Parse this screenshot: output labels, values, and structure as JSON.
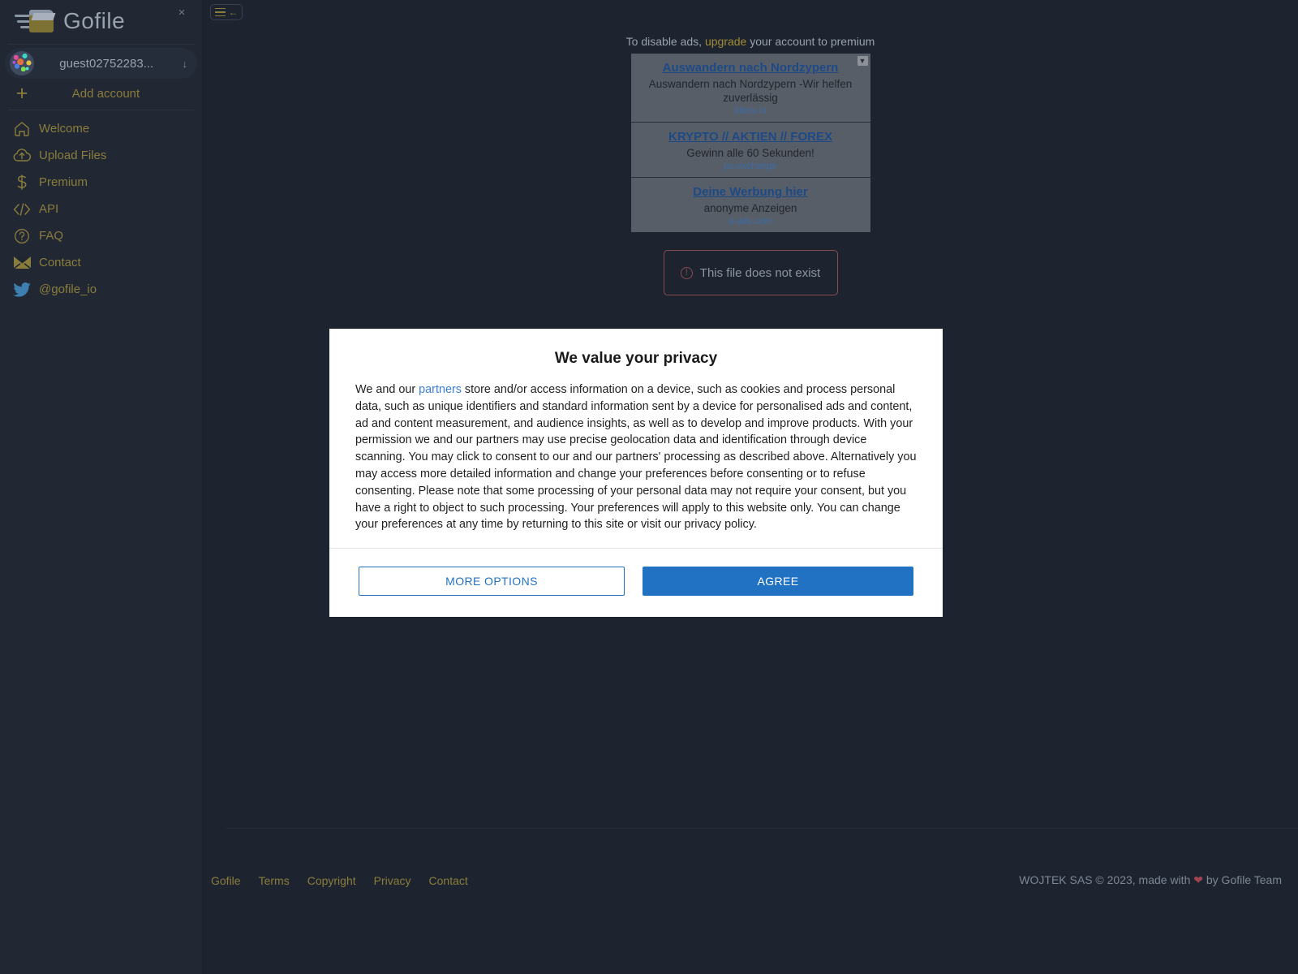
{
  "sidebar": {
    "brand": "Gofile",
    "close_label": "×",
    "account": {
      "name": "guest02752283...",
      "caret": "↓"
    },
    "add_account": {
      "plus": "+",
      "label": "Add account"
    },
    "nav_items": [
      {
        "icon": "home-icon",
        "label": "Welcome"
      },
      {
        "icon": "upload-icon",
        "label": "Upload Files"
      },
      {
        "icon": "dollar-icon",
        "label": "Premium"
      },
      {
        "icon": "code-icon",
        "label": "API"
      },
      {
        "icon": "question-icon",
        "label": "FAQ"
      },
      {
        "icon": "envelope-icon",
        "label": "Contact"
      },
      {
        "icon": "twitter-icon",
        "label": "@gofile_io"
      }
    ]
  },
  "topbar": {
    "menu_toggle_arrow": "←"
  },
  "ads": {
    "note_prefix": "To disable ads, ",
    "note_link": "upgrade",
    "note_suffix": " your account to premium",
    "adchoice_glyph": "▼",
    "items": [
      {
        "title": "Auswandern nach Nordzypern",
        "description": "Auswandern nach Nordzypern -Wir helfen zuverlässig",
        "url": "kibris.io"
      },
      {
        "title": "KRYPTO // AKTIEN // FOREX",
        "description": "Gewinn alle 60 Sekunden!",
        "url": "po.exchange"
      },
      {
        "title": "Deine Werbung hier",
        "description": "anonyme Anzeigen",
        "url": "a-ads.com"
      }
    ]
  },
  "error": {
    "icon_glyph": "!",
    "message": "This file does not exist"
  },
  "modal": {
    "title": "We value your privacy",
    "text_part1": "We and our ",
    "partners_link": "partners",
    "text_part2": " store and/or access information on a device, such as cookies and process personal data, such as unique identifiers and standard information sent by a device for personalised ads and content, ad and content measurement, and audience insights, as well as to develop and improve products. With your permission we and our partners may use precise geolocation data and identification through device scanning. You may click to consent to our and our partners' processing as described above. Alternatively you may access more detailed information and change your preferences before consenting or to refuse consenting. Please note that some processing of your personal data may not require your consent, but you have a right to object to such processing. Your preferences will apply to this website only. You can change your preferences at any time by returning to this site or visit our privacy policy.",
    "more_options_label": "MORE OPTIONS",
    "agree_label": "AGREE"
  },
  "footer": {
    "links": [
      "Gofile",
      "Terms",
      "Copyright",
      "Privacy",
      "Contact"
    ],
    "copyright_before": "WOJTEK SAS © 2023, made with ",
    "copyright_heart": "❤",
    "copyright_after": " by Gofile Team"
  },
  "colors": {
    "sidebar_bg": "#212733",
    "main_bg": "#1e242f",
    "accent_gold": "#8a7d3c",
    "ad_bg": "#585e68",
    "link_blue": "#2272c4",
    "error_red": "#8a4a52"
  }
}
